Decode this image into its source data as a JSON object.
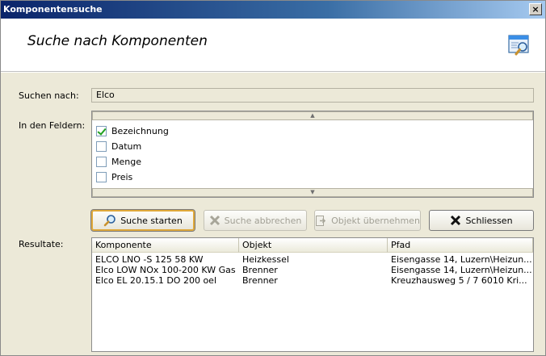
{
  "window": {
    "title": "Komponentensuche",
    "close_label": "×"
  },
  "header": {
    "heading": "Suche nach Komponenten",
    "icon": "search-window-icon"
  },
  "search": {
    "label": "Suchen nach:",
    "value": "Elco"
  },
  "fields": {
    "label": "In den Feldern:",
    "scroll_up": "▲",
    "scroll_down": "▼",
    "items": [
      {
        "label": "Bezeichnung",
        "checked": true
      },
      {
        "label": "Datum",
        "checked": false
      },
      {
        "label": "Menge",
        "checked": false
      },
      {
        "label": "Preis",
        "checked": false
      }
    ]
  },
  "buttons": {
    "start": "Suche starten",
    "abort": "Suche abbrechen",
    "take": "Objekt übernehmen",
    "close": "Schliessen"
  },
  "results": {
    "label": "Resultate:",
    "columns": [
      "Komponente",
      "Objekt",
      "Pfad"
    ],
    "rows": [
      [
        "ELCO LNO -S 125 58 KW",
        "Heizkessel",
        "Eisengasse 14, Luzern\\Heizun..."
      ],
      [
        "Elco LOW NOx 100-200 KW Gas",
        "Brenner",
        "Eisengasse 14, Luzern\\Heizun..."
      ],
      [
        "Elco EL 20.15.1 DO 200 oel",
        "Brenner",
        "Kreuzhausweg 5 / 7  6010 Kri..."
      ]
    ]
  },
  "colors": {
    "titlebar_start": "#0a246a",
    "titlebar_end": "#a6caf0",
    "dialog_bg": "#ece9d8",
    "default_button_border": "#e0a93a"
  }
}
